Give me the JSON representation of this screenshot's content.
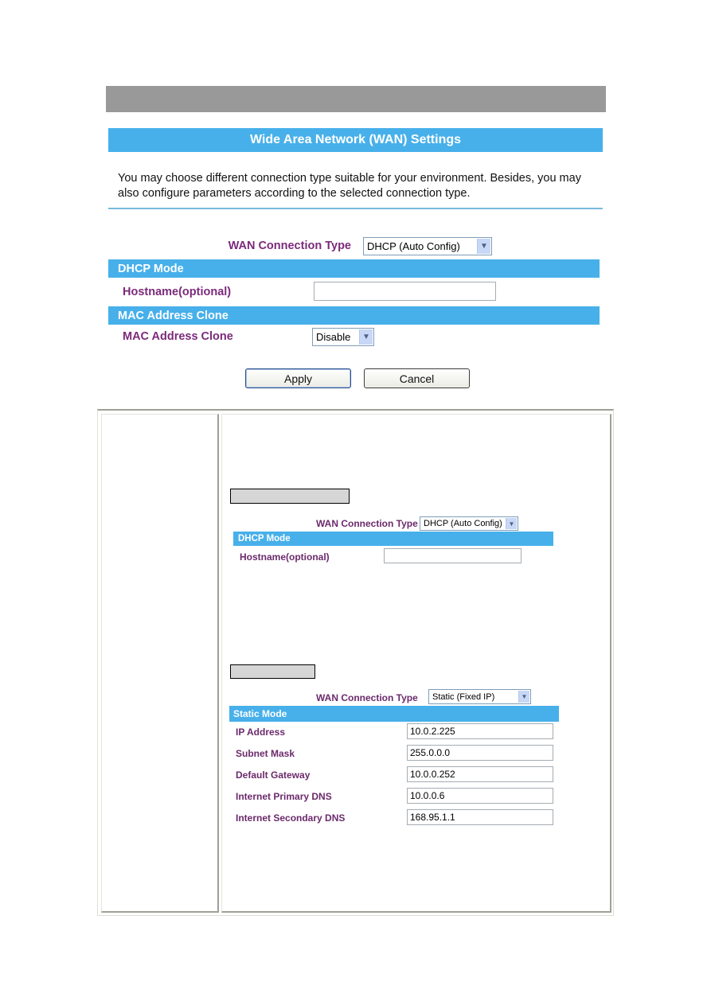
{
  "colors": {
    "header_blue": "#47b0ea",
    "label_purple": "#7b2a7b",
    "gray_bar": "#999999"
  },
  "wan_panel": {
    "title": "Wide Area Network (WAN) Settings",
    "description": "You may choose different connection type suitable for your environment. Besides, you may also configure parameters according to the selected connection type.",
    "connection_type_label": "WAN Connection Type",
    "connection_type_value": "DHCP (Auto Config)",
    "dhcp_section_title": "DHCP Mode",
    "hostname_label": "Hostname(optional)",
    "hostname_value": "",
    "mac_section_title": "MAC Address Clone",
    "mac_clone_label": "MAC Address Clone",
    "mac_clone_value": "Disable",
    "apply_label": "Apply",
    "cancel_label": "Cancel"
  },
  "doc_table": {
    "dhcp_example": {
      "caption": "",
      "connection_type_label": "WAN Connection Type",
      "connection_type_value": "DHCP (Auto Config)",
      "section_title": "DHCP Mode",
      "hostname_label": "Hostname(optional)",
      "hostname_value": ""
    },
    "static_example": {
      "caption": "",
      "connection_type_label": "WAN Connection Type",
      "connection_type_value": "Static (Fixed IP)",
      "section_title": "Static Mode",
      "fields": [
        {
          "label": "IP Address",
          "value": "10.0.2.225"
        },
        {
          "label": "Subnet Mask",
          "value": "255.0.0.0"
        },
        {
          "label": "Default Gateway",
          "value": "10.0.0.252"
        },
        {
          "label": "Internet Primary DNS",
          "value": "10.0.0.6"
        },
        {
          "label": "Internet Secondary DNS",
          "value": "168.95.1.1"
        }
      ]
    }
  },
  "icons": {
    "dropdown_arrow": "⌄"
  }
}
